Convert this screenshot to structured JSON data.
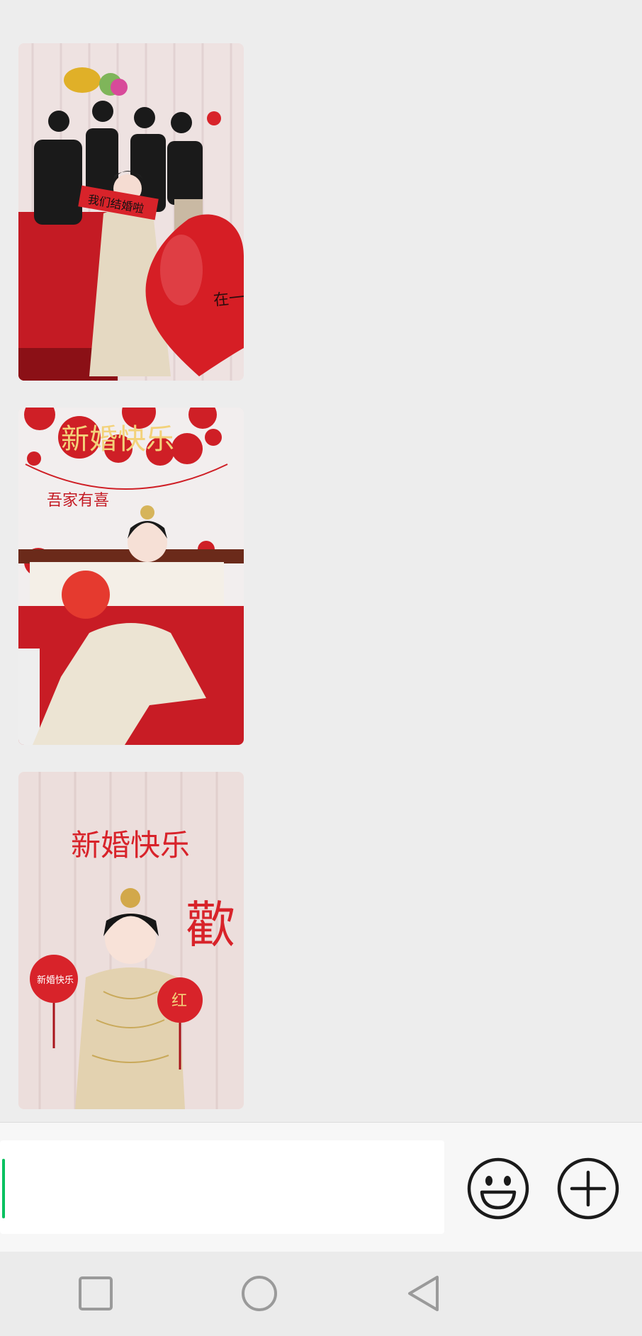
{
  "chat": {
    "images": [
      {
        "sign_text": "我们结婚啦",
        "balloon_text": "在一起"
      },
      {
        "wall_text": "新婚快乐",
        "banner_text": "吾家有喜"
      },
      {
        "wall_text": "新婚快乐",
        "right_char": "歡",
        "left_sign": "新婚快乐",
        "right_sign": "红"
      }
    ]
  },
  "composer": {
    "input_value": "",
    "caret_color": "#07c160"
  },
  "icons": {
    "emoji": "smiley-icon",
    "more": "plus-circle-icon"
  },
  "nav": [
    "recent-apps-icon",
    "home-icon",
    "back-icon"
  ],
  "colors": {
    "background": "#ededed",
    "accent": "#07c160",
    "festive_red": "#d8232a"
  }
}
